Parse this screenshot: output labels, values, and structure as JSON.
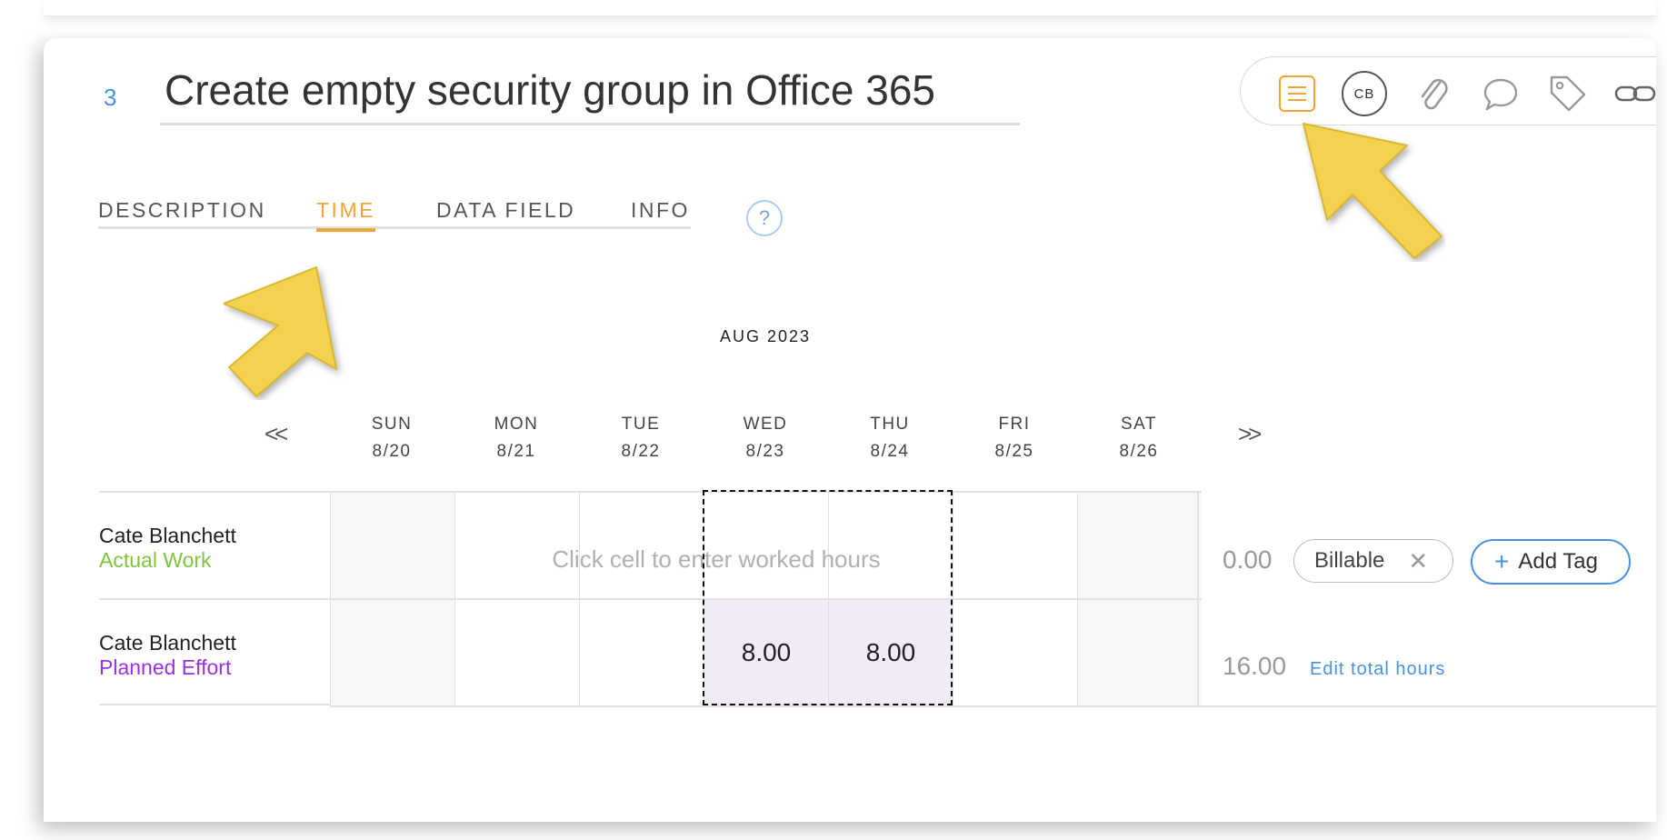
{
  "task": {
    "number": "3",
    "title": "Create empty security group in Office 365"
  },
  "toolbar": {
    "avatar_initials": "CB",
    "icons": [
      "list-icon",
      "avatar",
      "paperclip-icon",
      "comment-icon",
      "tag-icon",
      "link-icon"
    ],
    "accent_color": "#f2a33a"
  },
  "tabs": [
    {
      "label": "DESCRIPTION",
      "active": false
    },
    {
      "label": "TIME",
      "active": true
    },
    {
      "label": "DATA FIELD",
      "active": false
    },
    {
      "label": "INFO",
      "active": false
    }
  ],
  "help_label": "?",
  "calendar": {
    "month": "AUG 2023",
    "prev_label": "<<",
    "next_label": ">>",
    "days": [
      {
        "dow": "SUN",
        "date": "8/20"
      },
      {
        "dow": "MON",
        "date": "8/21"
      },
      {
        "dow": "TUE",
        "date": "8/22"
      },
      {
        "dow": "WED",
        "date": "8/23"
      },
      {
        "dow": "THU",
        "date": "8/24"
      },
      {
        "dow": "FRI",
        "date": "8/25"
      },
      {
        "dow": "SAT",
        "date": "8/26"
      }
    ]
  },
  "rows": [
    {
      "person": "Cate Blanchett",
      "kind": "Actual Work",
      "hint": "Click cell to enter worked hours",
      "values": [
        "",
        "",
        "",
        "",
        "",
        "",
        ""
      ],
      "total": "0.00",
      "billable_label": "Billable",
      "add_tag_label": "Add Tag"
    },
    {
      "person": "Cate Blanchett",
      "kind": "Planned Effort",
      "values": [
        "",
        "",
        "",
        "8.00",
        "8.00",
        "",
        ""
      ],
      "total": "16.00",
      "edit_total_label": "Edit total hours"
    }
  ]
}
